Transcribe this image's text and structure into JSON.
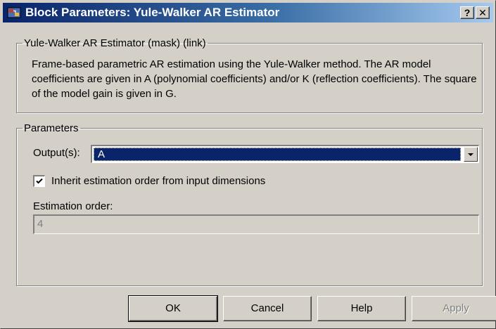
{
  "window": {
    "title": "Block Parameters: Yule-Walker AR Estimator",
    "help_glyph": "?",
    "close_glyph": "✕"
  },
  "description": {
    "group_title": "Yule-Walker AR Estimator (mask) (link)",
    "text": "Frame-based parametric AR estimation using the Yule-Walker method. The AR model coefficients are given in A (polynomial coefficients) and/or K (reflection coefficients). The square of the model gain is given in G."
  },
  "parameters": {
    "group_title": "Parameters",
    "output_label": "Output(s):",
    "output_value": "A",
    "inherit_label": "Inherit estimation order from input dimensions",
    "inherit_checked": true,
    "estimation_order_label": "Estimation order:",
    "estimation_order_value": "4"
  },
  "buttons": {
    "ok": "OK",
    "cancel": "Cancel",
    "help": "Help",
    "apply": "Apply"
  },
  "colors": {
    "title_bar": "#0a246a",
    "face": "#d4d0c8",
    "selection": "#0a246a"
  },
  "icons": {
    "app": "simulink-block-icon",
    "dropdown": "chevron-down-icon",
    "check": "check-icon"
  }
}
